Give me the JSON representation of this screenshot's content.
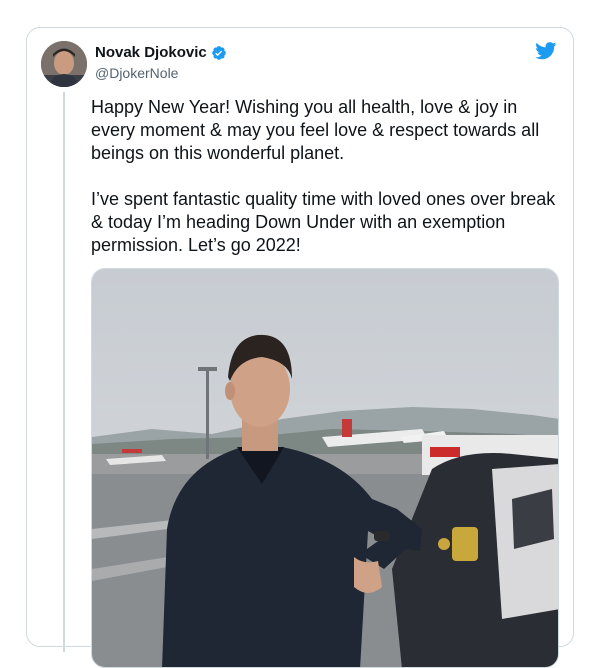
{
  "author": {
    "name": "Novak Djokovic",
    "handle": "@DjokerNole",
    "verified": true
  },
  "brand": {
    "accent": "#1d9bf0",
    "icon": "twitter-bird-icon"
  },
  "tweet": {
    "paragraphs": [
      "Happy New Year! Wishing you all health, love & joy in every moment & may you feel love & respect towards all beings on this wonderful planet.",
      "I’ve spent fantastic quality time with loved ones over break & today I’m heading Down Under with an exemption permission. Let’s go 2022!"
    ]
  },
  "media": {
    "type": "photo"
  }
}
